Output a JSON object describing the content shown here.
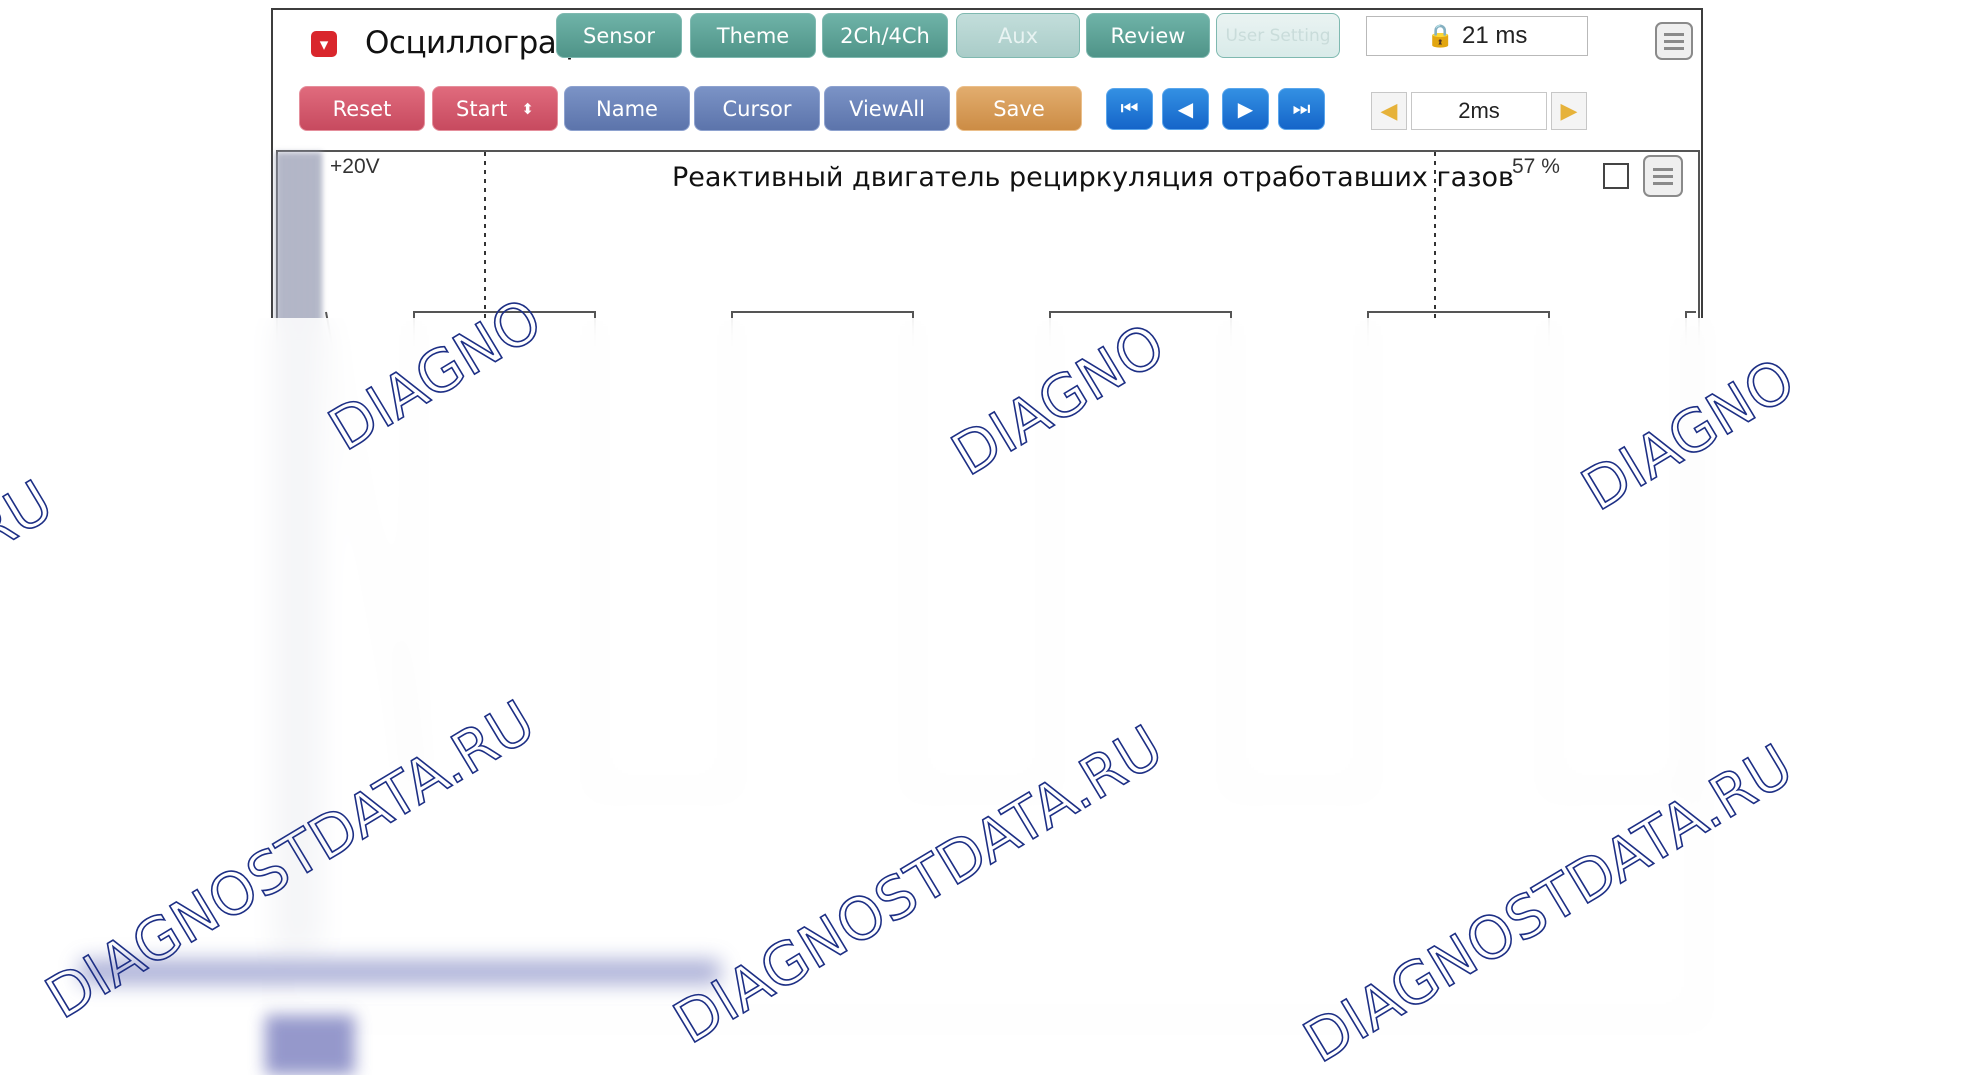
{
  "window": {
    "title": "Осциллограф",
    "app_icon": "dropdown-icon"
  },
  "tabs": [
    {
      "label": "Sensor",
      "state": "active"
    },
    {
      "label": "Theme",
      "state": "active"
    },
    {
      "label": "2Ch/4Ch",
      "state": "active"
    },
    {
      "label": "Aux",
      "state": "disabled"
    },
    {
      "label": "Review",
      "state": "active"
    },
    {
      "label": "User Setting",
      "state": "faded"
    }
  ],
  "time_display": {
    "icon": "lock-icon",
    "value": "21 ms"
  },
  "toolbar": {
    "reset": "Reset",
    "start": "Start",
    "start_icon": "updown-arrows-icon",
    "name": "Name",
    "cursor": "Cursor",
    "view_all": "ViewAll",
    "save": "Save"
  },
  "time_step": {
    "value": "2ms"
  },
  "channel": {
    "scale_label": "+20V",
    "title": "Реактивный двигатель рециркуляция отработавших газов",
    "duty_percent": "57 %"
  },
  "watermarks": {
    "text_a": "DIAGNO",
    "text_b": "DIAGNOSTDATA.RU",
    "color": "#1d2f85"
  },
  "chart_data": {
    "type": "line",
    "title": "Реактивный двигатель рециркуляция отработавших газов",
    "ylabel": "",
    "xlabel": "",
    "y_top_label": "+20V",
    "series": [
      {
        "name": "",
        "color": "#555555",
        "waveform": "pwm-square",
        "duty_percent": 57
      }
    ],
    "time_per_div": "2ms",
    "visible_time": "21 ms"
  }
}
